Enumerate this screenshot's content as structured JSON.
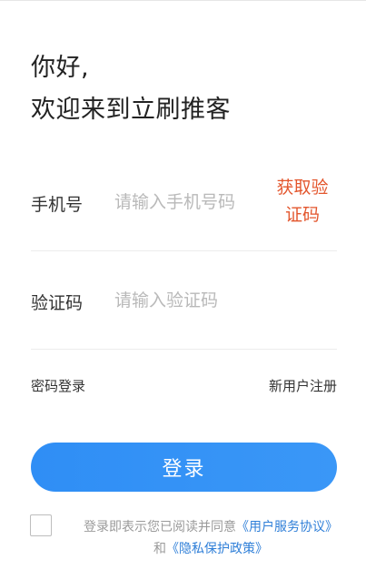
{
  "greeting": {
    "line1": "你好,",
    "line2": "欢迎来到立刷推客"
  },
  "phone": {
    "label": "手机号",
    "placeholder": "请输入手机号码",
    "get_code_line1": "获取验",
    "get_code_line2": "证码"
  },
  "code": {
    "label": "验证码",
    "placeholder": "请输入验证码"
  },
  "links": {
    "password_login": "密码登录",
    "new_user_register": "新用户注册"
  },
  "login_button": "登录",
  "agreement": {
    "prefix": "登录即表示您已阅读并同意",
    "user_service": "《用户服务协议》",
    "and": "和",
    "privacy": "《隐私保护政策》"
  },
  "colors": {
    "accent_blue": "#2f8ef5",
    "get_code_orange": "#e3562d",
    "link_blue": "#2f7fd8"
  }
}
